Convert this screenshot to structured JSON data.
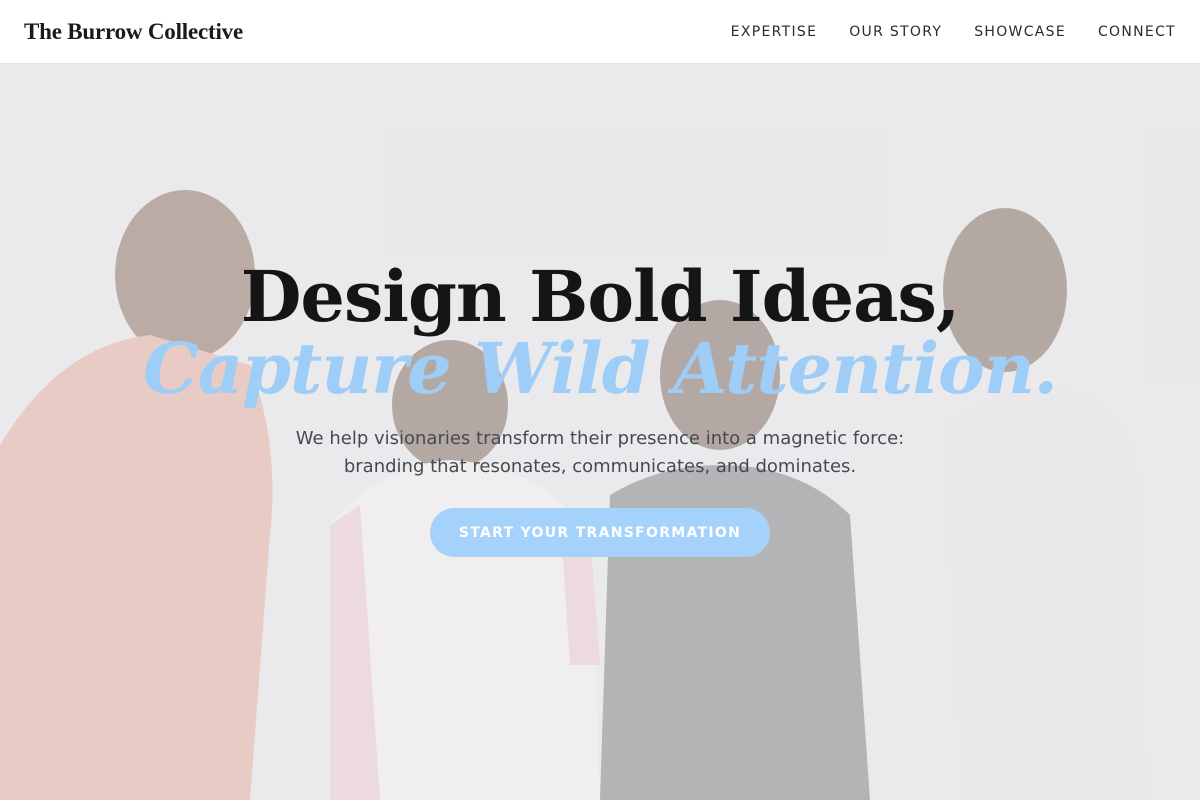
{
  "brand": {
    "name": "The Burrow Collective"
  },
  "nav": {
    "items": [
      {
        "label": "EXPERTISE"
      },
      {
        "label": "OUR STORY"
      },
      {
        "label": "SHOWCASE"
      },
      {
        "label": "CONNECT"
      }
    ]
  },
  "hero": {
    "headline": "Design Bold Ideas,",
    "subheadline": "Capture Wild Attention.",
    "description_line1": "We help visionaries transform their presence into a magnetic force:",
    "description_line2": "branding that resonates, communicates, and dominates.",
    "cta_label": "START YOUR TRANSFORMATION",
    "background_image": "four smiling young people in casual clothes standing together against a light grey wall"
  },
  "colors": {
    "accent": "#9ecdf7",
    "cta_background": "#a4d2fb",
    "heading_text": "#151515",
    "body_text": "#444a52",
    "header_background": "#ffffff"
  }
}
